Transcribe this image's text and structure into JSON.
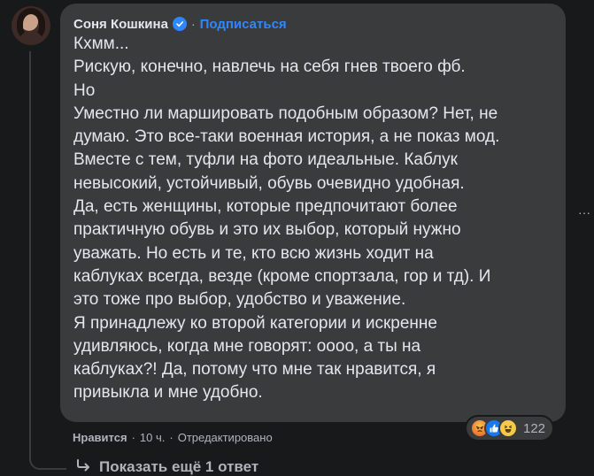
{
  "comment": {
    "author": "Соня Кошкина",
    "separator": "·",
    "subscribe_label": "Подписаться",
    "lines": [
      "Кхмм...",
      "Рискую, конечно, навлечь на себя гнев твоего фб.",
      "Но",
      "Уместно ли маршировать подобным образом? Нет, не",
      "думаю. Это все-таки военная история, а не показ мод.",
      "Вместе с тем, туфли на фото идеальные. Каблук",
      "невысокий, устойчивый, обувь очевидно удобная.",
      "Да, есть женщины, которые предпочитают более",
      "практичную обувь и это их выбор, который нужно",
      "уважать. Но есть и те, кто всю жизнь ходит на",
      "каблуках всегда, везде (кроме спортзала, гор и тд). И",
      "это тоже про выбор, удобство и уважение.",
      "Я принадлежу ко второй категории и искренне",
      "удивляюсь, когда мне говорят: оооо, а ты на",
      "каблуках?! Да, потому что мне так нравится, я",
      "привыкла и мне удобно."
    ],
    "more_label": "···",
    "reactions": {
      "icons": [
        "angry-icon",
        "like-icon",
        "haha-icon"
      ],
      "count": "122"
    },
    "meta": {
      "like_label": "Нравится",
      "sep1": "·",
      "time": "10 ч.",
      "sep2": "·",
      "edited": "Отредактировано"
    },
    "replies_label": "Показать ещё 1 ответ"
  },
  "colors": {
    "background": "#18191a",
    "bubble": "#3a3b3c",
    "accent": "#2d88ff",
    "text": "#e4e6eb",
    "secondary": "#b0b3b8"
  }
}
